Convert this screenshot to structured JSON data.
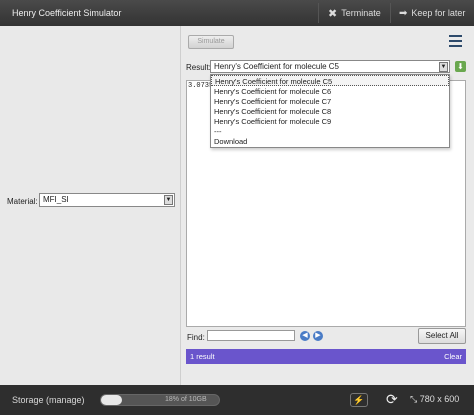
{
  "app": {
    "title": "Henry Coefficient Simulator",
    "terminate_label": "Terminate",
    "keep_label": "Keep for later"
  },
  "left": {
    "material_label": "Material:",
    "material_value": "MFI_SI"
  },
  "right": {
    "simulate_label": "Simulate",
    "result_label": "Result:",
    "result_selected": "Henry's Coefficient for molecule C5",
    "result_value": "3.0735",
    "options": [
      "Henry's Coefficient for molecule C5",
      "Henry's Coefficient for molecule C6",
      "Henry's Coefficient for molecule C7",
      "Henry's Coefficient for molecule C8",
      "Henry's Coefficient for molecule C9",
      "---",
      "Download"
    ],
    "selected_index": 0
  },
  "find": {
    "label": "Find:",
    "value": "",
    "select_all_label": "Select All"
  },
  "results": {
    "count_text": "1 result",
    "clear_label": "Clear"
  },
  "status": {
    "storage_label": "Storage (manage)",
    "storage_text": "18% of 10GB",
    "storage_fraction": 0.18,
    "size_label": "780 x 600"
  },
  "icons": {
    "terminate": "close-icon",
    "keep": "forward-icon",
    "menu": "hamburger-icon",
    "download": "download-icon",
    "find_prev": "arrow-left-icon",
    "find_next": "arrow-right-icon",
    "flash": "lightning-icon",
    "refresh": "refresh-icon",
    "resize": "resize-icon"
  },
  "colors": {
    "results_bar": "#6a55cc",
    "titlebar": "#3b3b3b"
  }
}
